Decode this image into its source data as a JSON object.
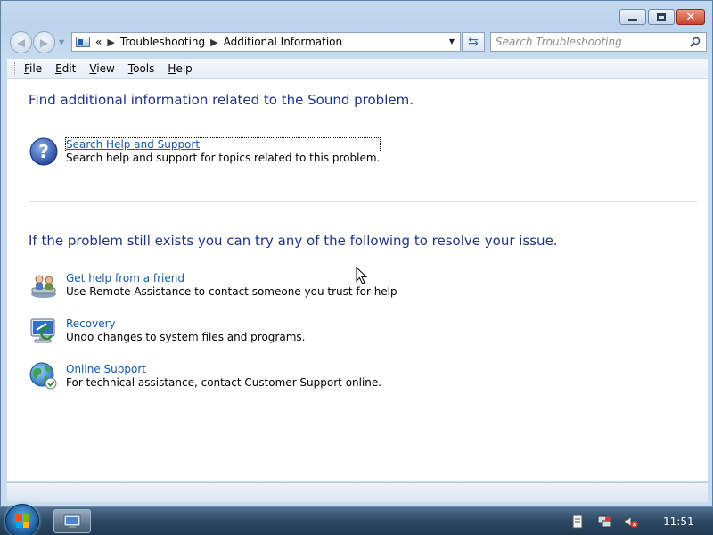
{
  "window": {
    "breadcrumb": [
      "Troubleshooting",
      "Additional Information"
    ],
    "breadcrumb_overflow": "«",
    "search_placeholder": "Search Troubleshooting"
  },
  "menu": [
    {
      "label": "File",
      "key": "F",
      "rest": "ile"
    },
    {
      "label": "Edit",
      "key": "E",
      "rest": "dit"
    },
    {
      "label": "View",
      "key": "V",
      "rest": "iew"
    },
    {
      "label": "Tools",
      "key": "T",
      "rest": "ools"
    },
    {
      "label": "Help",
      "key": "H",
      "rest": "elp"
    }
  ],
  "content": {
    "heading1": "Find additional information related to the Sound problem.",
    "search_help": {
      "link": "Search Help and Support",
      "desc": "Search help and support for topics related to this problem.",
      "icon": "help-icon"
    },
    "heading2": "If the problem still exists you can try any of the following to resolve your issue.",
    "options": [
      {
        "link": "Get help from a friend",
        "desc": "Use Remote Assistance to contact someone you trust for help",
        "icon": "remote-assistance-icon"
      },
      {
        "link": "Recovery",
        "desc": "Undo changes to system files and programs.",
        "icon": "recovery-icon"
      },
      {
        "link": "Online Support",
        "desc": "For technical assistance, contact Customer Support online.",
        "icon": "online-support-icon"
      }
    ]
  },
  "taskbar": {
    "clock": "11:51",
    "tray_icons": [
      "action-center-icon",
      "network-icon",
      "volume-muted-icon"
    ]
  }
}
